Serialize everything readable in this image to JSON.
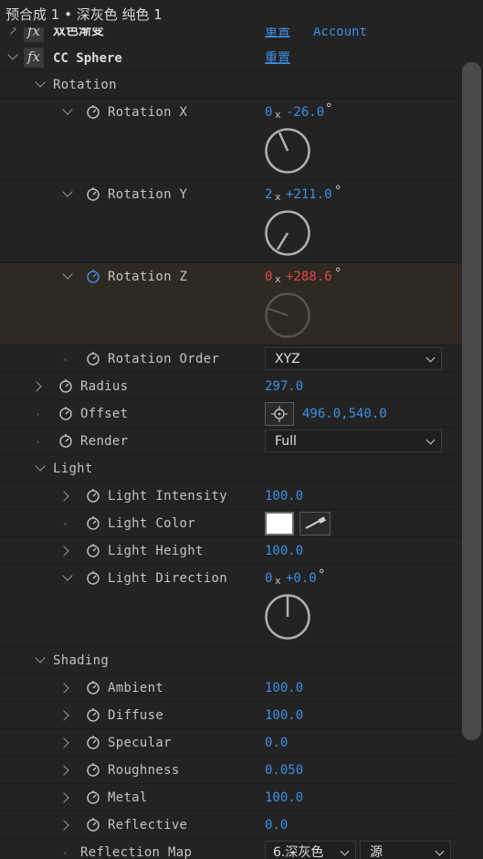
{
  "window": {
    "title": "预合成 1 • 深灰色 纯色 1"
  },
  "effects": [
    {
      "name": "双色渐变",
      "reset": "重置",
      "about": "Account"
    },
    {
      "name": "CC Sphere",
      "reset": "重置"
    }
  ],
  "groups": {
    "rotation": "Rotation",
    "light": "Light",
    "shading": "Shading"
  },
  "rotation": {
    "x": {
      "label": "Rotation X",
      "rev": "0",
      "mult": "x",
      "deg": "-26.0",
      "unit": "°"
    },
    "y": {
      "label": "Rotation Y",
      "rev": "2",
      "mult": "x",
      "deg": "+211.0",
      "unit": "°"
    },
    "z": {
      "label": "Rotation Z",
      "rev": "0",
      "mult": "x",
      "deg": "+288.6",
      "unit": "°"
    },
    "order": {
      "label": "Rotation Order",
      "value": "XYZ"
    }
  },
  "radius": {
    "label": "Radius",
    "value": "297.0"
  },
  "offset": {
    "label": "Offset",
    "value": "496.0,540.0"
  },
  "render": {
    "label": "Render",
    "value": "Full"
  },
  "light": {
    "intensity": {
      "label": "Light Intensity",
      "value": "100.0"
    },
    "color": {
      "label": "Light Color",
      "swatch": "#ffffff"
    },
    "height": {
      "label": "Light Height",
      "value": "100.0"
    },
    "direction": {
      "label": "Light Direction",
      "rev": "0",
      "mult": "x",
      "deg": "+0.0",
      "unit": "°"
    }
  },
  "shading": {
    "ambient": {
      "label": "Ambient",
      "value": "100.0"
    },
    "diffuse": {
      "label": "Diffuse",
      "value": "100.0"
    },
    "specular": {
      "label": "Specular",
      "value": "0.0"
    },
    "roughness": {
      "label": "Roughness",
      "value": "0.050"
    },
    "metal": {
      "label": "Metal",
      "value": "100.0"
    },
    "reflective": {
      "label": "Reflective",
      "value": "0.0"
    }
  },
  "reflection_map": {
    "label": "Reflection Map",
    "layer": "6.深灰色",
    "source": "源"
  },
  "colors": {
    "accent": "#3d8fe4",
    "keyframed": "#e04646",
    "panel": "#232323",
    "highlight": "#2e2a22"
  }
}
